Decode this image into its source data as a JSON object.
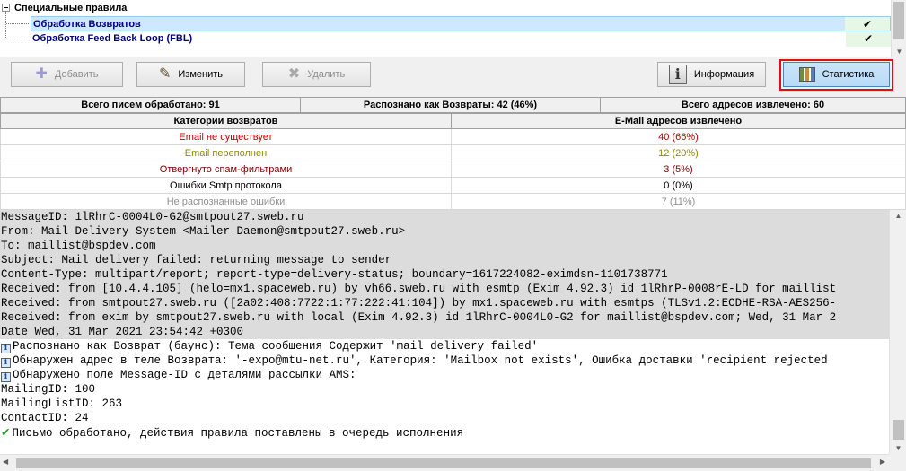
{
  "tree": {
    "root_label": "Специальные правила",
    "items": [
      {
        "label": "Обработка Возвратов",
        "checked": true,
        "selected": true
      },
      {
        "label": "Обработка Feed Back Loop (FBL)",
        "checked": true,
        "selected": false
      }
    ]
  },
  "toolbar": {
    "add_label": "Добавить",
    "edit_label": "Изменить",
    "delete_label": "Удалить",
    "info_label": "Информация",
    "stats_label": "Статистика"
  },
  "summary": {
    "total_processed": "Всего писем обработано: 91",
    "recognized_bounces": "Распознано как Возвраты: 42 (46%)",
    "total_addresses": "Всего адресов извлечено: 60"
  },
  "categories": {
    "col_category": "Категории возвратов",
    "col_emails": "E-Mail адресов извлечено",
    "rows": [
      {
        "category": "Email не существует",
        "count": "40 (66%)",
        "color": "#c00000"
      },
      {
        "category": "Email переполнен",
        "count": "12 (20%)",
        "color": "#8a8a00"
      },
      {
        "category": "Отвергнуто спам-фильтрами",
        "count": "3 (5%)",
        "color": "#800000"
      },
      {
        "category": "Ошибки Smtp протокола",
        "count": "0 (0%)",
        "color": "#000000"
      },
      {
        "category": "Не распознанные ошибки",
        "count": "7 (11%)",
        "color": "#909090"
      }
    ]
  },
  "log": {
    "header_lines": [
      "MessageID: 1lRhrC-0004L0-G2@smtpout27.sweb.ru",
      "From: Mail Delivery System <Mailer-Daemon@smtpout27.sweb.ru>",
      "To: maillist@bspdev.com",
      "Subject: Mail delivery failed: returning message to sender",
      "Content-Type: multipart/report; report-type=delivery-status; boundary=1617224082-eximdsn-1101738771",
      "Received: from [10.4.4.105] (helo=mx1.spaceweb.ru) by vh66.sweb.ru with esmtp (Exim 4.92.3) id 1lRhrP-0008rE-LD for maillist",
      "Received: from smtpout27.sweb.ru ([2a02:408:7722:1:77:222:41:104]) by mx1.spaceweb.ru with esmtps (TLSv1.2:ECDHE-RSA-AES256-",
      "Received: from exim by smtpout27.sweb.ru with local (Exim 4.92.3) id 1lRhrC-0004L0-G2 for maillist@bspdev.com; Wed, 31 Mar 2",
      "Date Wed, 31 Mar 2021 23:54:42 +0300"
    ],
    "info_lines": [
      "Распознано как Возврат (баунс): Тема сообщения Содержит 'mail delivery failed'",
      "Обнаружен адрес в теле Возврата: '-expo@mtu-net.ru', Категория: 'Mailbox not exists', Ошибка доставки 'recipient rejected",
      "Обнаружено поле Message-ID с деталями рассылки AMS:"
    ],
    "plain_lines": [
      "MailingID: 100",
      "MailingListID: 263",
      "ContactID: 24"
    ],
    "result_line": "Письмо обработано, действия правила поставлены в очередь исполнения"
  }
}
